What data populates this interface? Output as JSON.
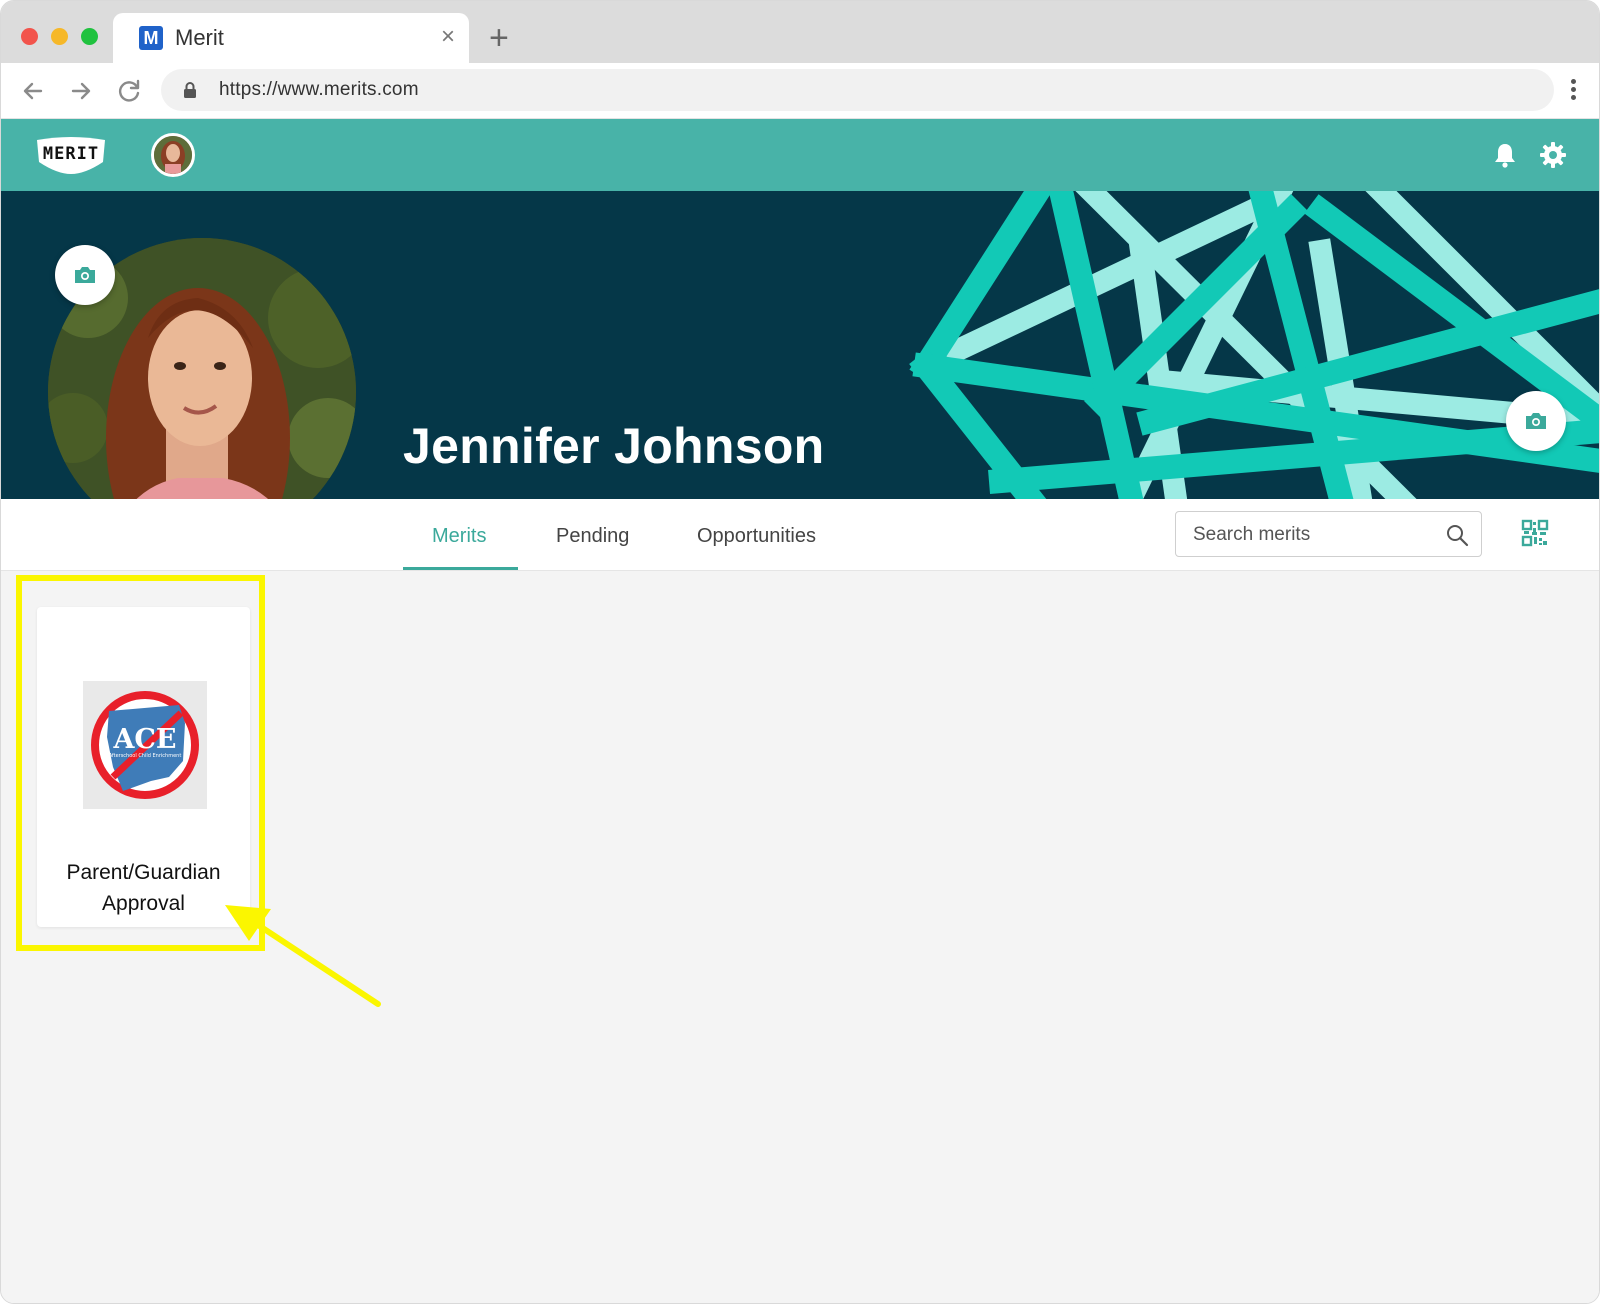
{
  "browser": {
    "tab_favicon": "M",
    "tab_title": "Merit",
    "tab_close": "×",
    "new_tab": "+",
    "url": "https://www.merits.com"
  },
  "header": {
    "logo_text": "MERIT",
    "icons": [
      "bell-icon",
      "gear-icon"
    ]
  },
  "profile": {
    "name": "Jennifer Johnson"
  },
  "tabs": [
    {
      "label": "Merits",
      "active": true
    },
    {
      "label": "Pending",
      "active": false
    },
    {
      "label": "Opportunities",
      "active": false
    }
  ],
  "search": {
    "placeholder": "Search merits"
  },
  "merits": [
    {
      "logo_text": "ACE",
      "logo_subtext": "Afterschool Child Enrichment",
      "title_line1": "Parent/Guardian",
      "title_line2": "Approval"
    }
  ],
  "colors": {
    "header": "#48b3a8",
    "banner": "#053748",
    "accent": "#3ba99b",
    "highlight": "#fbf600"
  }
}
